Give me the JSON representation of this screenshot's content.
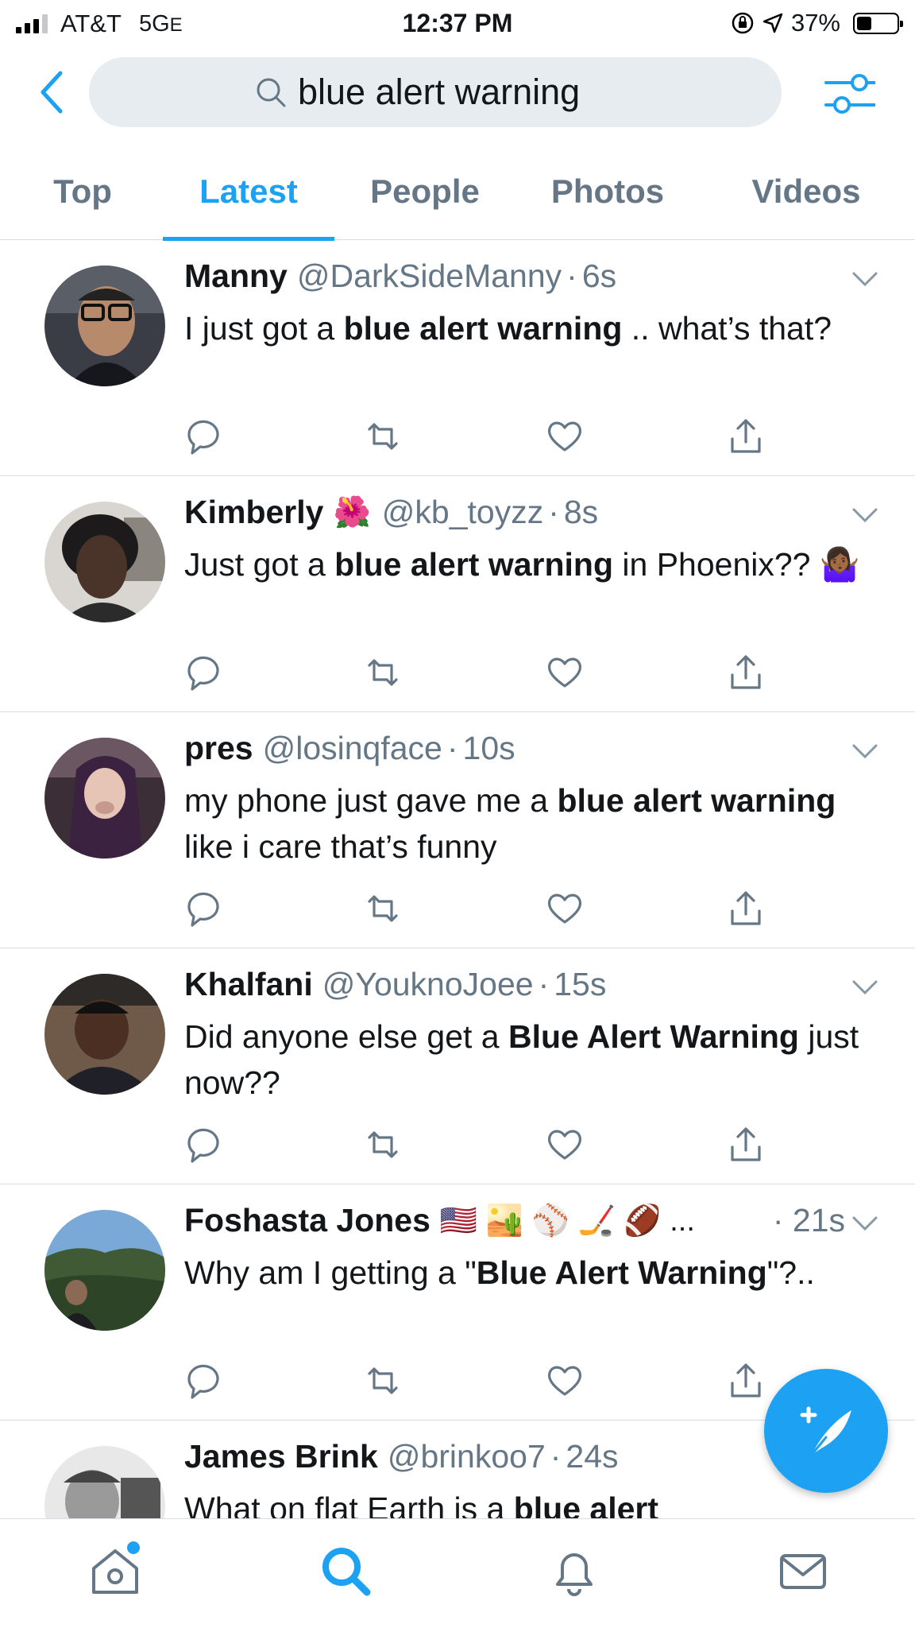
{
  "status_bar": {
    "carrier": "AT&T",
    "network": "5G",
    "network_suffix": "E",
    "time": "12:37 PM",
    "battery": "37%",
    "battery_level": 0.37
  },
  "search": {
    "query": "blue alert warning"
  },
  "tabs": [
    {
      "label": "Top",
      "active": false
    },
    {
      "label": "Latest",
      "active": true
    },
    {
      "label": "People",
      "active": false
    },
    {
      "label": "Photos",
      "active": false
    },
    {
      "label": "Videos",
      "active": false
    }
  ],
  "tweets": [
    {
      "name": "Manny",
      "name_emoji": "",
      "handle": "@DarkSideManny",
      "time": "6s",
      "text_html": "I just got a <b>blue alert warning</b> .. what’s that?"
    },
    {
      "name": "Kimberly",
      "name_emoji": "🌺",
      "handle": "@kb_toyzz",
      "time": "8s",
      "text_html": "Just got a <b>blue alert warning</b>  in Phoenix?? 🤷🏾‍♀️"
    },
    {
      "name": "pres",
      "name_emoji": "",
      "handle": "@losinqface",
      "time": "10s",
      "text_html": "my phone just gave me a <b>blue alert warning</b> like i care that’s funny"
    },
    {
      "name": "Khalfani",
      "name_emoji": "",
      "handle": "@YouknoJoee",
      "time": "15s",
      "text_html": "Did anyone else get a <b>Blue Alert Warning</b> just now??"
    },
    {
      "name": "Foshasta Jones",
      "name_emoji": "🇺🇸 🏜️ ⚾ 🏒 🏈 ...",
      "handle": "",
      "time": "21s",
      "text_html": "Why am I getting a \"<b>Blue Alert Warning</b>\"?.."
    },
    {
      "name": "James Brink",
      "name_emoji": "",
      "handle": "@brinkoo7",
      "time": "24s",
      "text_html": "What on flat Earth is a <b>blue alert</b>"
    }
  ],
  "colors": {
    "accent": "#1da1f2",
    "secondary_text": "#657786",
    "divider": "#d8dde1"
  },
  "icons": {
    "back": "chevron-left-icon",
    "filter": "sliders-icon",
    "reply": "reply-icon",
    "retweet": "retweet-icon",
    "like": "heart-icon",
    "share": "share-icon",
    "compose": "compose-tweet-icon",
    "home": "home-icon",
    "search": "search-icon",
    "notifications": "bell-icon",
    "messages": "mail-icon"
  }
}
